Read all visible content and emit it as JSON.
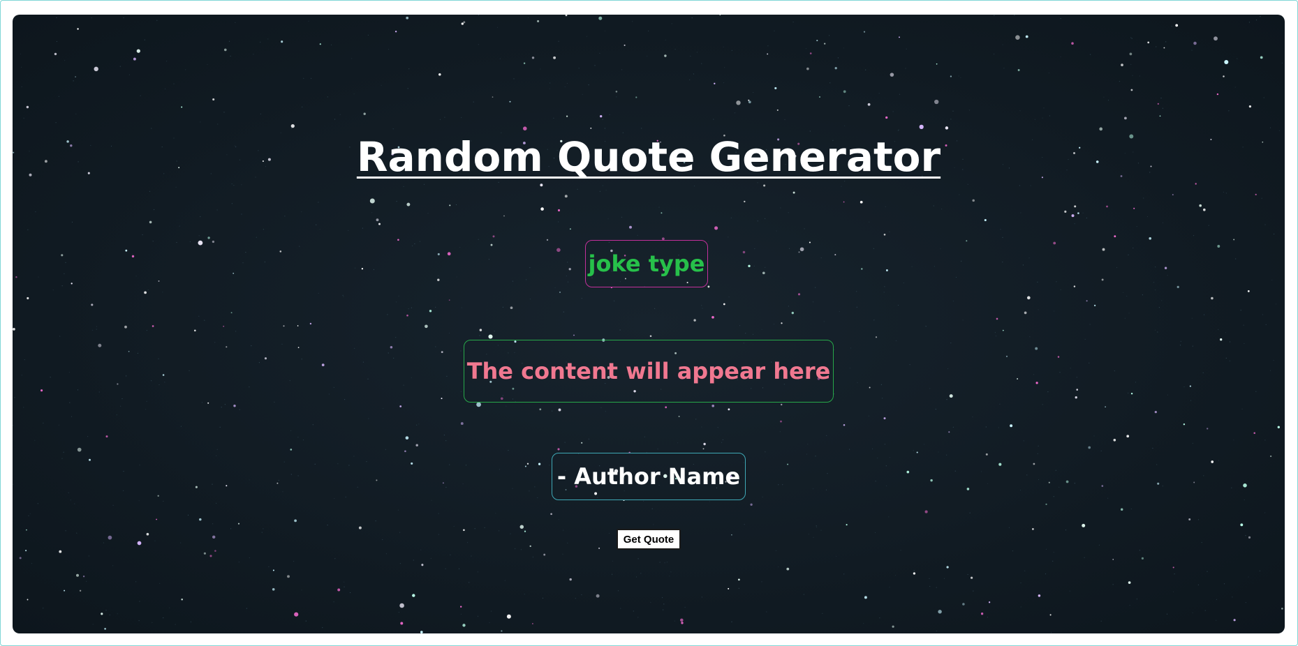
{
  "page": {
    "title": "Random Quote Generator"
  },
  "quote": {
    "type": "joke type",
    "content": "The content will appear here",
    "author": "- Author Name"
  },
  "controls": {
    "get_quote_label": "Get Quote"
  },
  "colors": {
    "background": "#111b23",
    "title": "#ffffff",
    "type_text": "#27c04a",
    "type_border": "#c3309b",
    "content_text": "#f07890",
    "content_border": "#27a849",
    "author_text": "#ffffff",
    "author_border": "#3fa9b6"
  }
}
